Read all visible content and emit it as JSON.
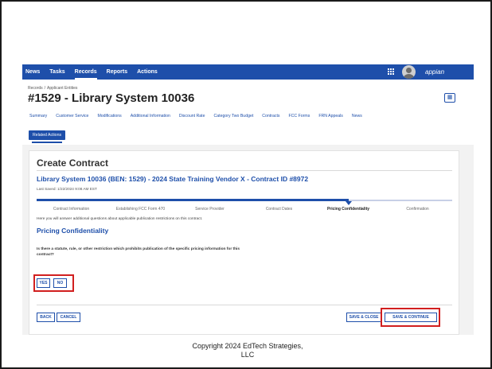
{
  "topnav": {
    "items": [
      {
        "label": "News",
        "active": false
      },
      {
        "label": "Tasks",
        "active": false
      },
      {
        "label": "Records",
        "active": true
      },
      {
        "label": "Reports",
        "active": false
      },
      {
        "label": "Actions",
        "active": false
      }
    ],
    "brand": "appian",
    "icons": [
      "apps-grid-icon",
      "user-avatar"
    ],
    "color": "#1e4faa"
  },
  "header": {
    "breadcrumb": [
      "Records",
      "Applicant Entities"
    ],
    "breadcrumb_sep": "/",
    "title": "#1529 - Library System 10036",
    "record_icon": "record-card-icon",
    "tabs": [
      "Summary",
      "Customer Service",
      "Modifications",
      "Additional Information",
      "Discount Rate",
      "Category Two Budget",
      "Contracts",
      "FCC Forms",
      "FRN Appeals",
      "News"
    ],
    "related_actions": "Related Actions"
  },
  "form": {
    "title": "Create Contract",
    "contract_heading": "Library System 10036 (BEN: 1529) - 2024 State Training Vendor X - Contract ID #8972",
    "last_saved": "Last Saved: 1/22/2024 9:08 AM EST",
    "progress": {
      "steps": [
        "Contract Information",
        "Establishing FCC Form 470",
        "Service Provider",
        "Contract Dates",
        "Pricing Confidentiality",
        "Confirmation"
      ],
      "current_index": 4,
      "completed_fraction": 0.75
    },
    "intro": "Here you will answer additional questions about applicable publication restrictions on this contract.",
    "section_title": "Pricing Confidentiality",
    "question": "Is there a statute, rule, or other restriction which prohibits publication of the specific pricing information for this contract?",
    "buttons": {
      "yes": "YES",
      "no": "NO",
      "back": "BACK",
      "cancel": "CANCEL",
      "save_close": "SAVE & CLOSE",
      "save_continue": "SAVE & CONTINUE"
    },
    "highlight_color": "#d11f1f"
  },
  "footer": {
    "copyright_line1": "Copyright 2024 EdTech Strategies,",
    "copyright_line2": "LLC"
  }
}
